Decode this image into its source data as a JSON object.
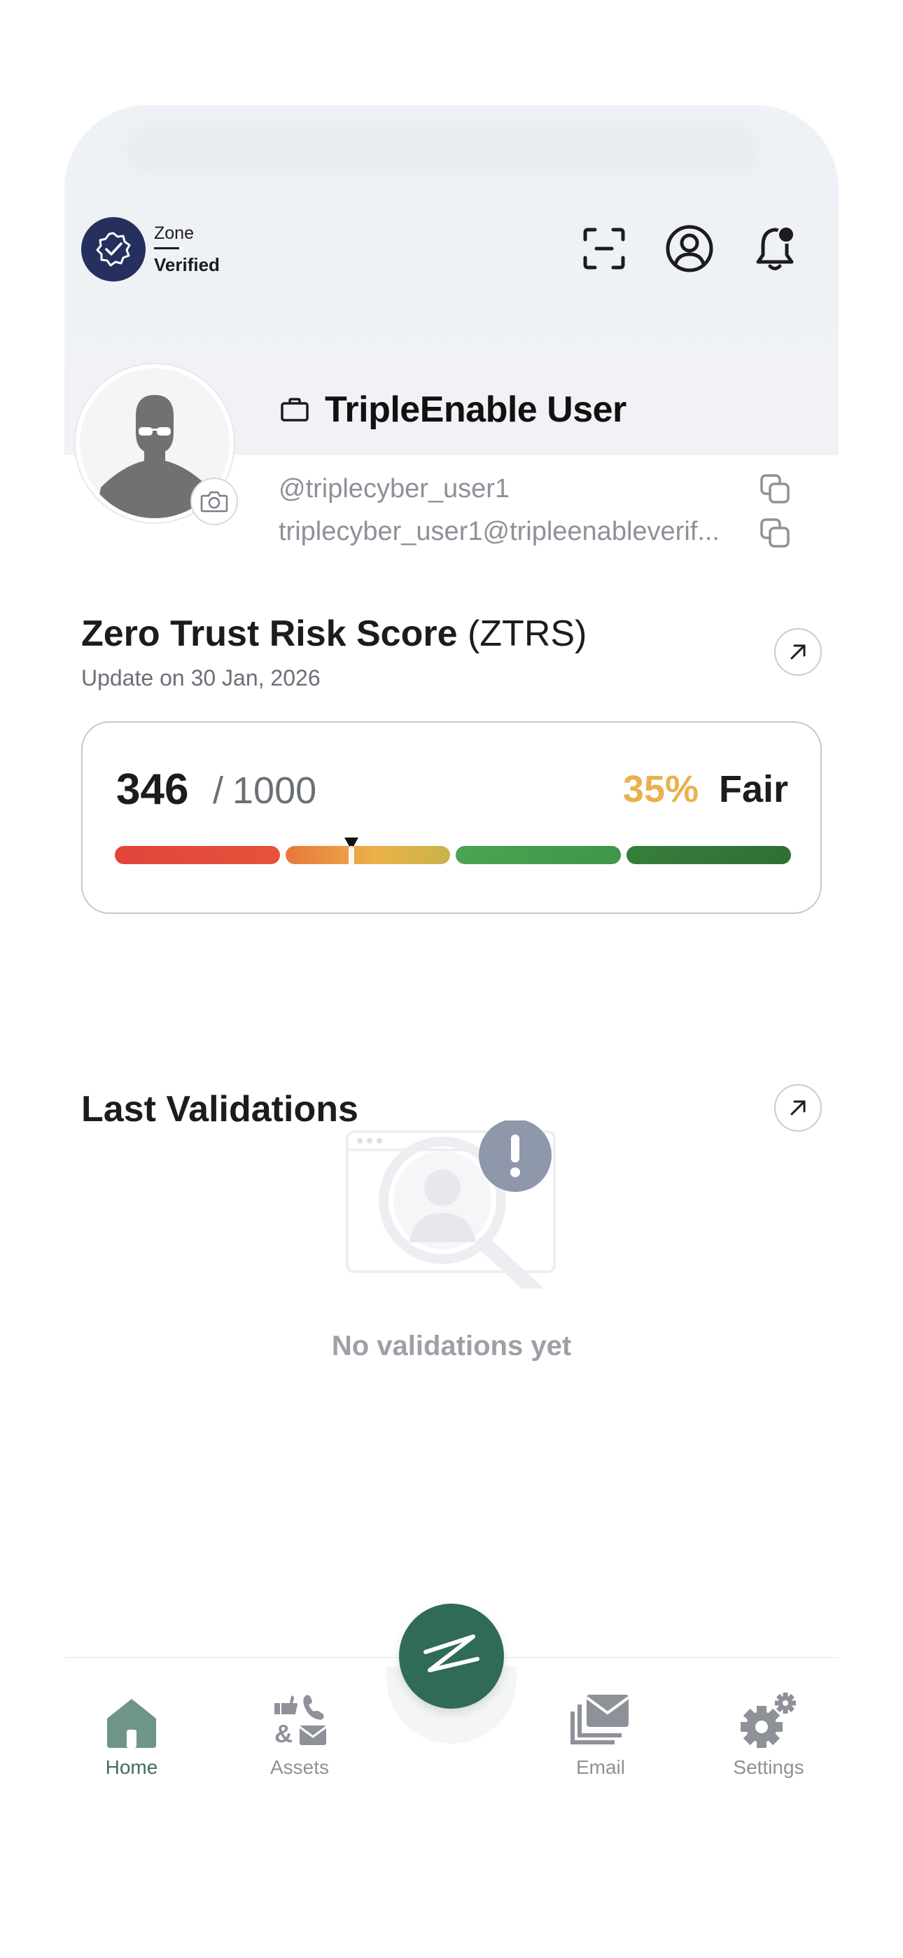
{
  "header": {
    "zone_title": "Zone",
    "zone_status": "Verified"
  },
  "profile": {
    "name": "TripleEnable User",
    "handle": "@triplecyber_user1",
    "email": "triplecyber_user1@tripleenableverif..."
  },
  "ztrs": {
    "title_bold": "Zero Trust Risk Score",
    "title_suffix": " (ZTRS)",
    "updated": "Update on 30 Jan, 2026",
    "score": "346",
    "separator": "/",
    "max": "1000",
    "percent_text": "35%",
    "percent_value": 0.35,
    "rating": "Fair",
    "colors": {
      "percent": "#e9b14f",
      "segments": [
        "#e2443b",
        "#ecb149",
        "#4ca352",
        "#2f6f35"
      ]
    }
  },
  "validations": {
    "title": "Last Validations",
    "empty_text": "No validations yet"
  },
  "tabbar": {
    "items": [
      {
        "label": "Home",
        "icon": "home-icon",
        "active": true
      },
      {
        "label": "Assets",
        "icon": "assets-icon",
        "active": false
      },
      {
        "label": "Email",
        "icon": "email-icon",
        "active": false
      },
      {
        "label": "Settings",
        "icon": "settings-icon",
        "active": false
      }
    ],
    "center_icon": "brand-logo-icon",
    "active_color": "#3e6d63",
    "fab_color": "#2f6b55"
  }
}
